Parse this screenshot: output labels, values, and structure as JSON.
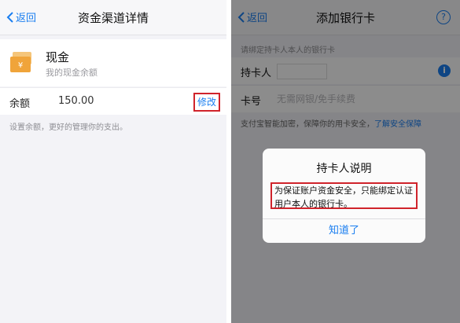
{
  "left": {
    "nav": {
      "back_label": "返回",
      "title": "资金渠道详情"
    },
    "cash": {
      "icon": "cash-wallet-icon",
      "title": "现金",
      "subtitle": "我的现金余额"
    },
    "balance": {
      "label": "余额",
      "value": "150.00",
      "edit_label": "修改"
    },
    "hint": "设置余额，更好的管理你的支出。"
  },
  "right": {
    "nav": {
      "back_label": "返回",
      "title": "添加银行卡",
      "help_icon": "question-icon"
    },
    "tip": "请绑定持卡人本人的银行卡",
    "holder": {
      "label": "持卡人",
      "info_icon": "info-icon"
    },
    "card": {
      "label": "卡号",
      "placeholder": "无需网银/免手续费"
    },
    "secure_text": "支付宝智能加密，保障你的用卡安全，",
    "secure_link": "了解安全保障",
    "dialog": {
      "title": "持卡人说明",
      "message": "为保证账户资金安全，只能绑定认证用户本人的银行卡。",
      "button": "知道了"
    }
  },
  "colors": {
    "accent": "#1a7ef0",
    "highlight_red": "#d0232b",
    "cash_icon_orange": "#f0a43a"
  }
}
